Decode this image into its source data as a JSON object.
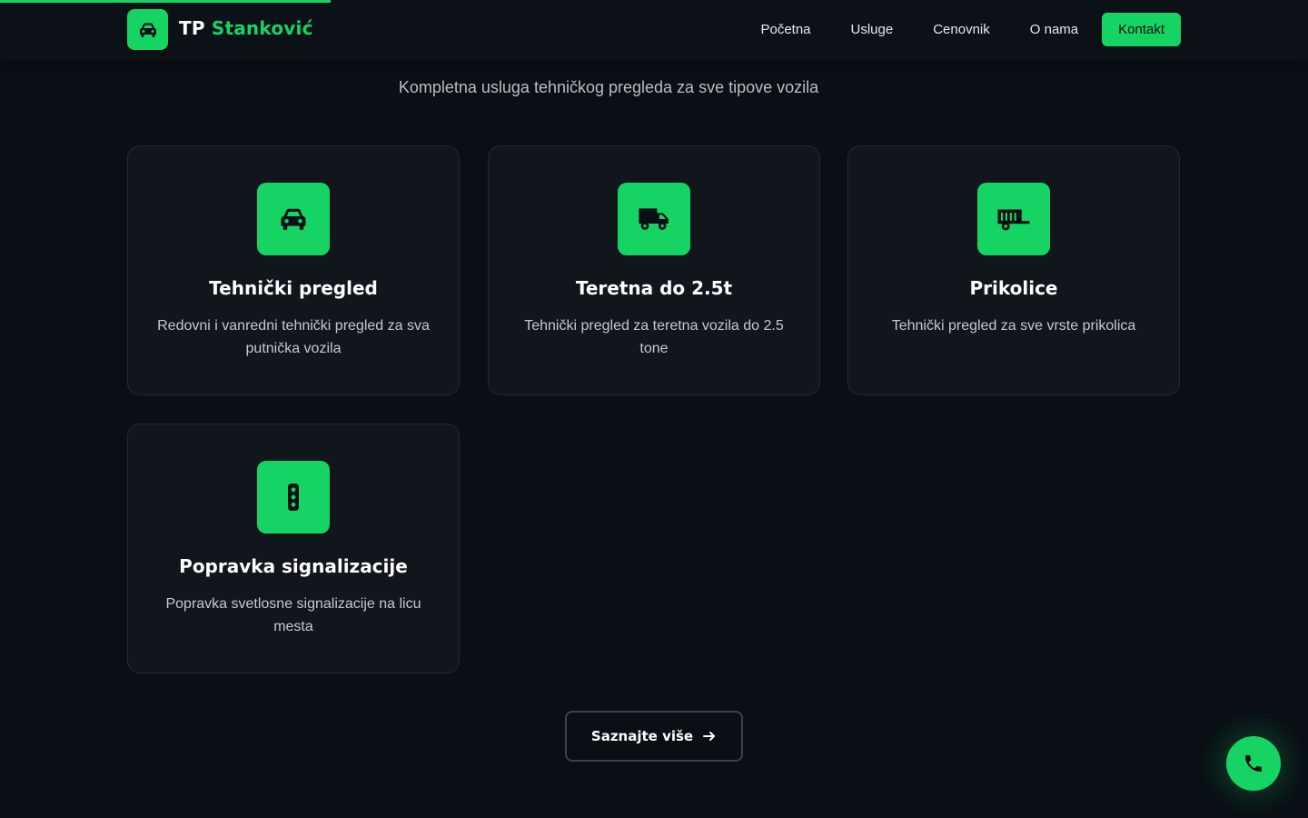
{
  "header": {
    "brand_prefix": "TP",
    "brand_name": "Stanković",
    "logo_icon": "car-icon",
    "nav": [
      {
        "label": "Početna"
      },
      {
        "label": "Usluge"
      },
      {
        "label": "Cenovnik"
      },
      {
        "label": "O nama"
      }
    ],
    "cta_label": "Kontakt"
  },
  "section": {
    "subtitle": "Kompletna usluga tehničkog pregleda za sve tipove vozila"
  },
  "services": [
    {
      "icon": "car-icon",
      "title": "Tehnički pregled",
      "desc": "Redovni i vanredni tehnički pregled za sva putnička vozila"
    },
    {
      "icon": "truck-icon",
      "title": "Teretna do 2.5t",
      "desc": "Tehnički pregled za teretna vozila do 2.5 tone"
    },
    {
      "icon": "trailer-icon",
      "title": "Prikolice",
      "desc": "Tehnički pregled za sve vrste prikolica"
    },
    {
      "icon": "traffic-light-icon",
      "title": "Popravka signalizacije",
      "desc": "Popravka svetlosne signalizacije na licu mesta"
    }
  ],
  "more_button": {
    "label": "Saznajte više",
    "icon": "arrow-right-icon"
  },
  "phone_fab": {
    "icon": "phone-icon"
  },
  "colors": {
    "accent": "#16d463",
    "background": "#0a0f15",
    "card": "#11161d"
  }
}
